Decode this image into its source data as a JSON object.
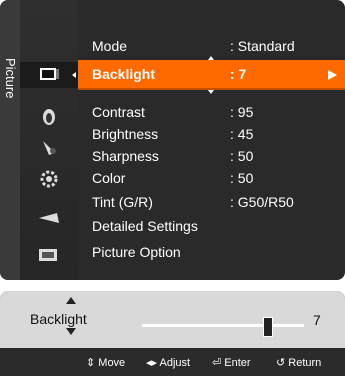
{
  "menu": {
    "category": "Picture",
    "items": [
      {
        "label": "Mode",
        "value": ": Standard"
      },
      {
        "label": "Backlight",
        "value": ": 7"
      },
      {
        "label": "Contrast",
        "value": ": 95"
      },
      {
        "label": "Brightness",
        "value": ": 45"
      },
      {
        "label": "Sharpness",
        "value": ": 50"
      },
      {
        "label": "Color",
        "value": ": 50"
      },
      {
        "label": "Tint (G/R)",
        "value": ": G50/R50"
      },
      {
        "label": "Detailed Settings",
        "value": ""
      },
      {
        "label": "Picture Option",
        "value": ""
      }
    ],
    "selected_label": "Backlight",
    "selected_color": "#ff6a00"
  },
  "icons": [
    "picture-icon",
    "sound-icon",
    "channel-icon",
    "setup-icon",
    "input-icon",
    "application-icon"
  ],
  "slider": {
    "label": "Backlight",
    "value": "7",
    "level": 0.78
  },
  "help": {
    "move": "Move",
    "adjust": "Adjust",
    "enter": "Enter",
    "return": "Return"
  }
}
